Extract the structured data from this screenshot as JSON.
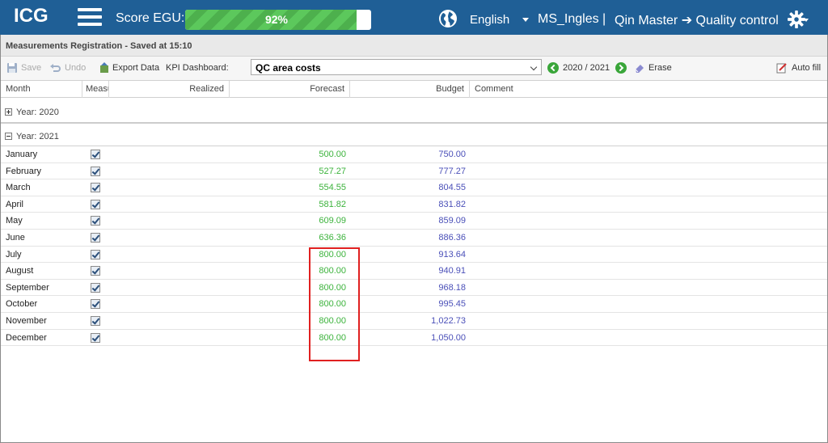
{
  "header": {
    "logo": "ICG",
    "score_label": "Score EGU:",
    "score_value": "92%",
    "score_fraction": 0.92,
    "language": "English",
    "user": "MS_Ingles",
    "separator": "|",
    "path": "Qin Master ➔ Quality control"
  },
  "titlebar": {
    "title": "Measurements Registration - Saved at 15:10"
  },
  "toolbar": {
    "save": "Save",
    "undo": "Undo",
    "export": "Export Data",
    "kpi_label": "KPI Dashboard:",
    "kpi_value": "QC area costs",
    "period": "2020 / 2021",
    "erase": "Erase",
    "autofill": "Auto fill"
  },
  "grid": {
    "columns": [
      "Month",
      "Measu",
      "Realized",
      "Forecast",
      "Budget",
      "Comment"
    ],
    "groups": [
      {
        "label": "Year: 2020",
        "expanded": false
      },
      {
        "label": "Year: 2021",
        "expanded": true
      }
    ],
    "rows": [
      {
        "month": "January",
        "checked": true,
        "forecast": "500.00",
        "budget": "750.00"
      },
      {
        "month": "February",
        "checked": true,
        "forecast": "527.27",
        "budget": "777.27"
      },
      {
        "month": "March",
        "checked": true,
        "forecast": "554.55",
        "budget": "804.55"
      },
      {
        "month": "April",
        "checked": true,
        "forecast": "581.82",
        "budget": "831.82"
      },
      {
        "month": "May",
        "checked": true,
        "forecast": "609.09",
        "budget": "859.09"
      },
      {
        "month": "June",
        "checked": true,
        "forecast": "636.36",
        "budget": "886.36"
      },
      {
        "month": "July",
        "checked": true,
        "forecast": "800.00",
        "budget": "913.64"
      },
      {
        "month": "August",
        "checked": true,
        "forecast": "800.00",
        "budget": "940.91"
      },
      {
        "month": "September",
        "checked": true,
        "forecast": "800.00",
        "budget": "968.18"
      },
      {
        "month": "October",
        "checked": true,
        "forecast": "800.00",
        "budget": "995.45"
      },
      {
        "month": "November",
        "checked": true,
        "forecast": "800.00",
        "budget": "1,022.73"
      },
      {
        "month": "December",
        "checked": true,
        "forecast": "800.00",
        "budget": "1,050.00"
      }
    ]
  },
  "colors": {
    "header_bg": "#1f5f96",
    "forecast": "#3cb33c",
    "budget": "#4a4fb8",
    "highlight": "#e02020",
    "progress": "#5cc85c"
  }
}
